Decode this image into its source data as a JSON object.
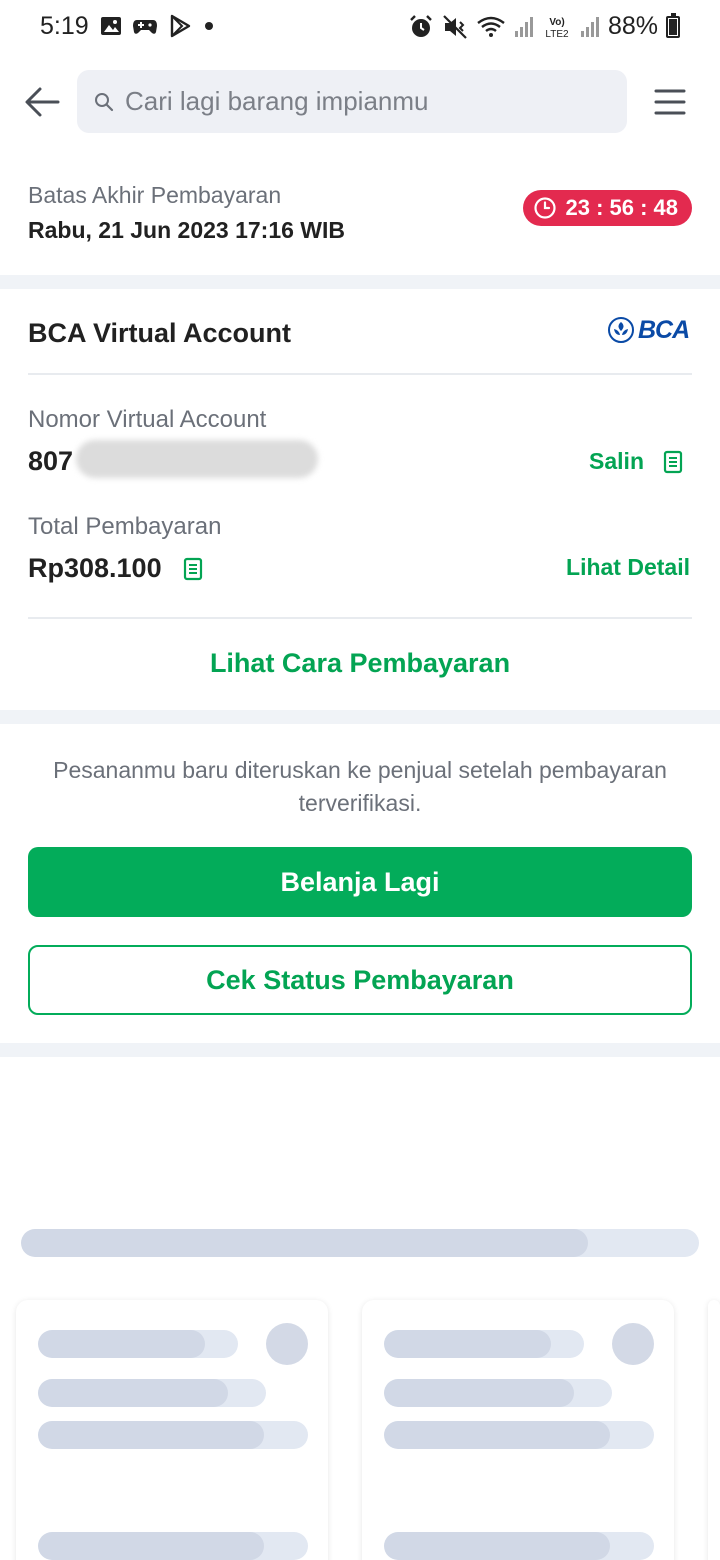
{
  "status_bar": {
    "time": "5:19",
    "battery": "88%",
    "left_icons": [
      "gallery-icon",
      "game-controller-icon",
      "play-store-icon",
      "dot-icon"
    ],
    "right_icons": [
      "alarm-icon",
      "mute-vibrate-icon",
      "wifi-icon",
      "signal-icon",
      "volte-lte2-icon",
      "signal-icon",
      "battery-icon"
    ],
    "volte_label": "Vo)\nLTE2"
  },
  "header": {
    "search_placeholder": "Cari lagi barang impianmu"
  },
  "deadline": {
    "label": "Batas Akhir Pembayaran",
    "date": "Rabu, 21 Jun 2023 17:16 WIB",
    "countdown": "23 : 56 : 48"
  },
  "payment": {
    "method_title": "BCA Virtual Account",
    "bank_logo_text": "BCA",
    "va_label": "Nomor Virtual Account",
    "va_number_visible": "807",
    "copy_label": "Salin",
    "total_label": "Total Pembayaran",
    "total_value": "Rp308.100",
    "detail_label": "Lihat Detail",
    "how_to_pay": "Lihat Cara Pembayaran"
  },
  "info": {
    "note": "Pesananmu baru diteruskan ke penjual setelah pembayaran terverifikasi."
  },
  "actions": {
    "shop_again": "Belanja Lagi",
    "check_status": "Cek Status Pembayaran"
  },
  "colors": {
    "green": "#03ac5a",
    "green_text": "#03a453",
    "timer_red": "#e32a4f",
    "bca_blue": "#0a4aa6",
    "divider": "#f0f3f7"
  }
}
